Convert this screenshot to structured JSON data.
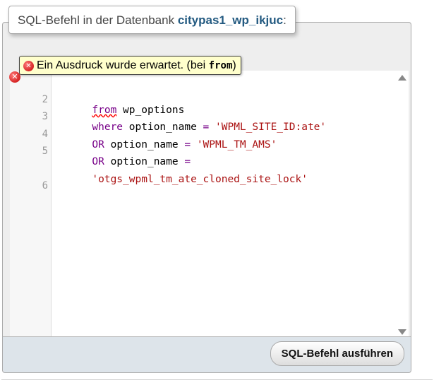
{
  "legend": {
    "prefix": "SQL-Befehl in der Datenbank ",
    "database": "citypas1_wp_ikjuc",
    "suffix": ":"
  },
  "editor": {
    "line_numbers": [
      "2",
      "3",
      "4",
      "5",
      "",
      "6"
    ],
    "lines": {
      "l2_keyword": "from",
      "l2_rest": " wp_options",
      "l3_keyword": "where",
      "l3_col": " option_name ",
      "l3_op": "=",
      "l3_value": " 'WPML_SITE_ID:ate'",
      "l4_keyword": "OR",
      "l4_col": " option_name ",
      "l4_op": "=",
      "l4_value": " 'WPML_TM_AMS'",
      "l5_keyword": "OR",
      "l5_col": " option_name ",
      "l5_op": "=",
      "l5_value_wrapped": "'otgs_wpml_tm_ate_cloned_site_lock'"
    }
  },
  "error": {
    "marker": "✕",
    "icon": "✕",
    "message_prefix": "Ein Ausdruck wurde erwartet. (bei ",
    "message_keyword": "from",
    "message_suffix": ")"
  },
  "footer": {
    "go_label": "SQL-Befehl ausführen"
  }
}
